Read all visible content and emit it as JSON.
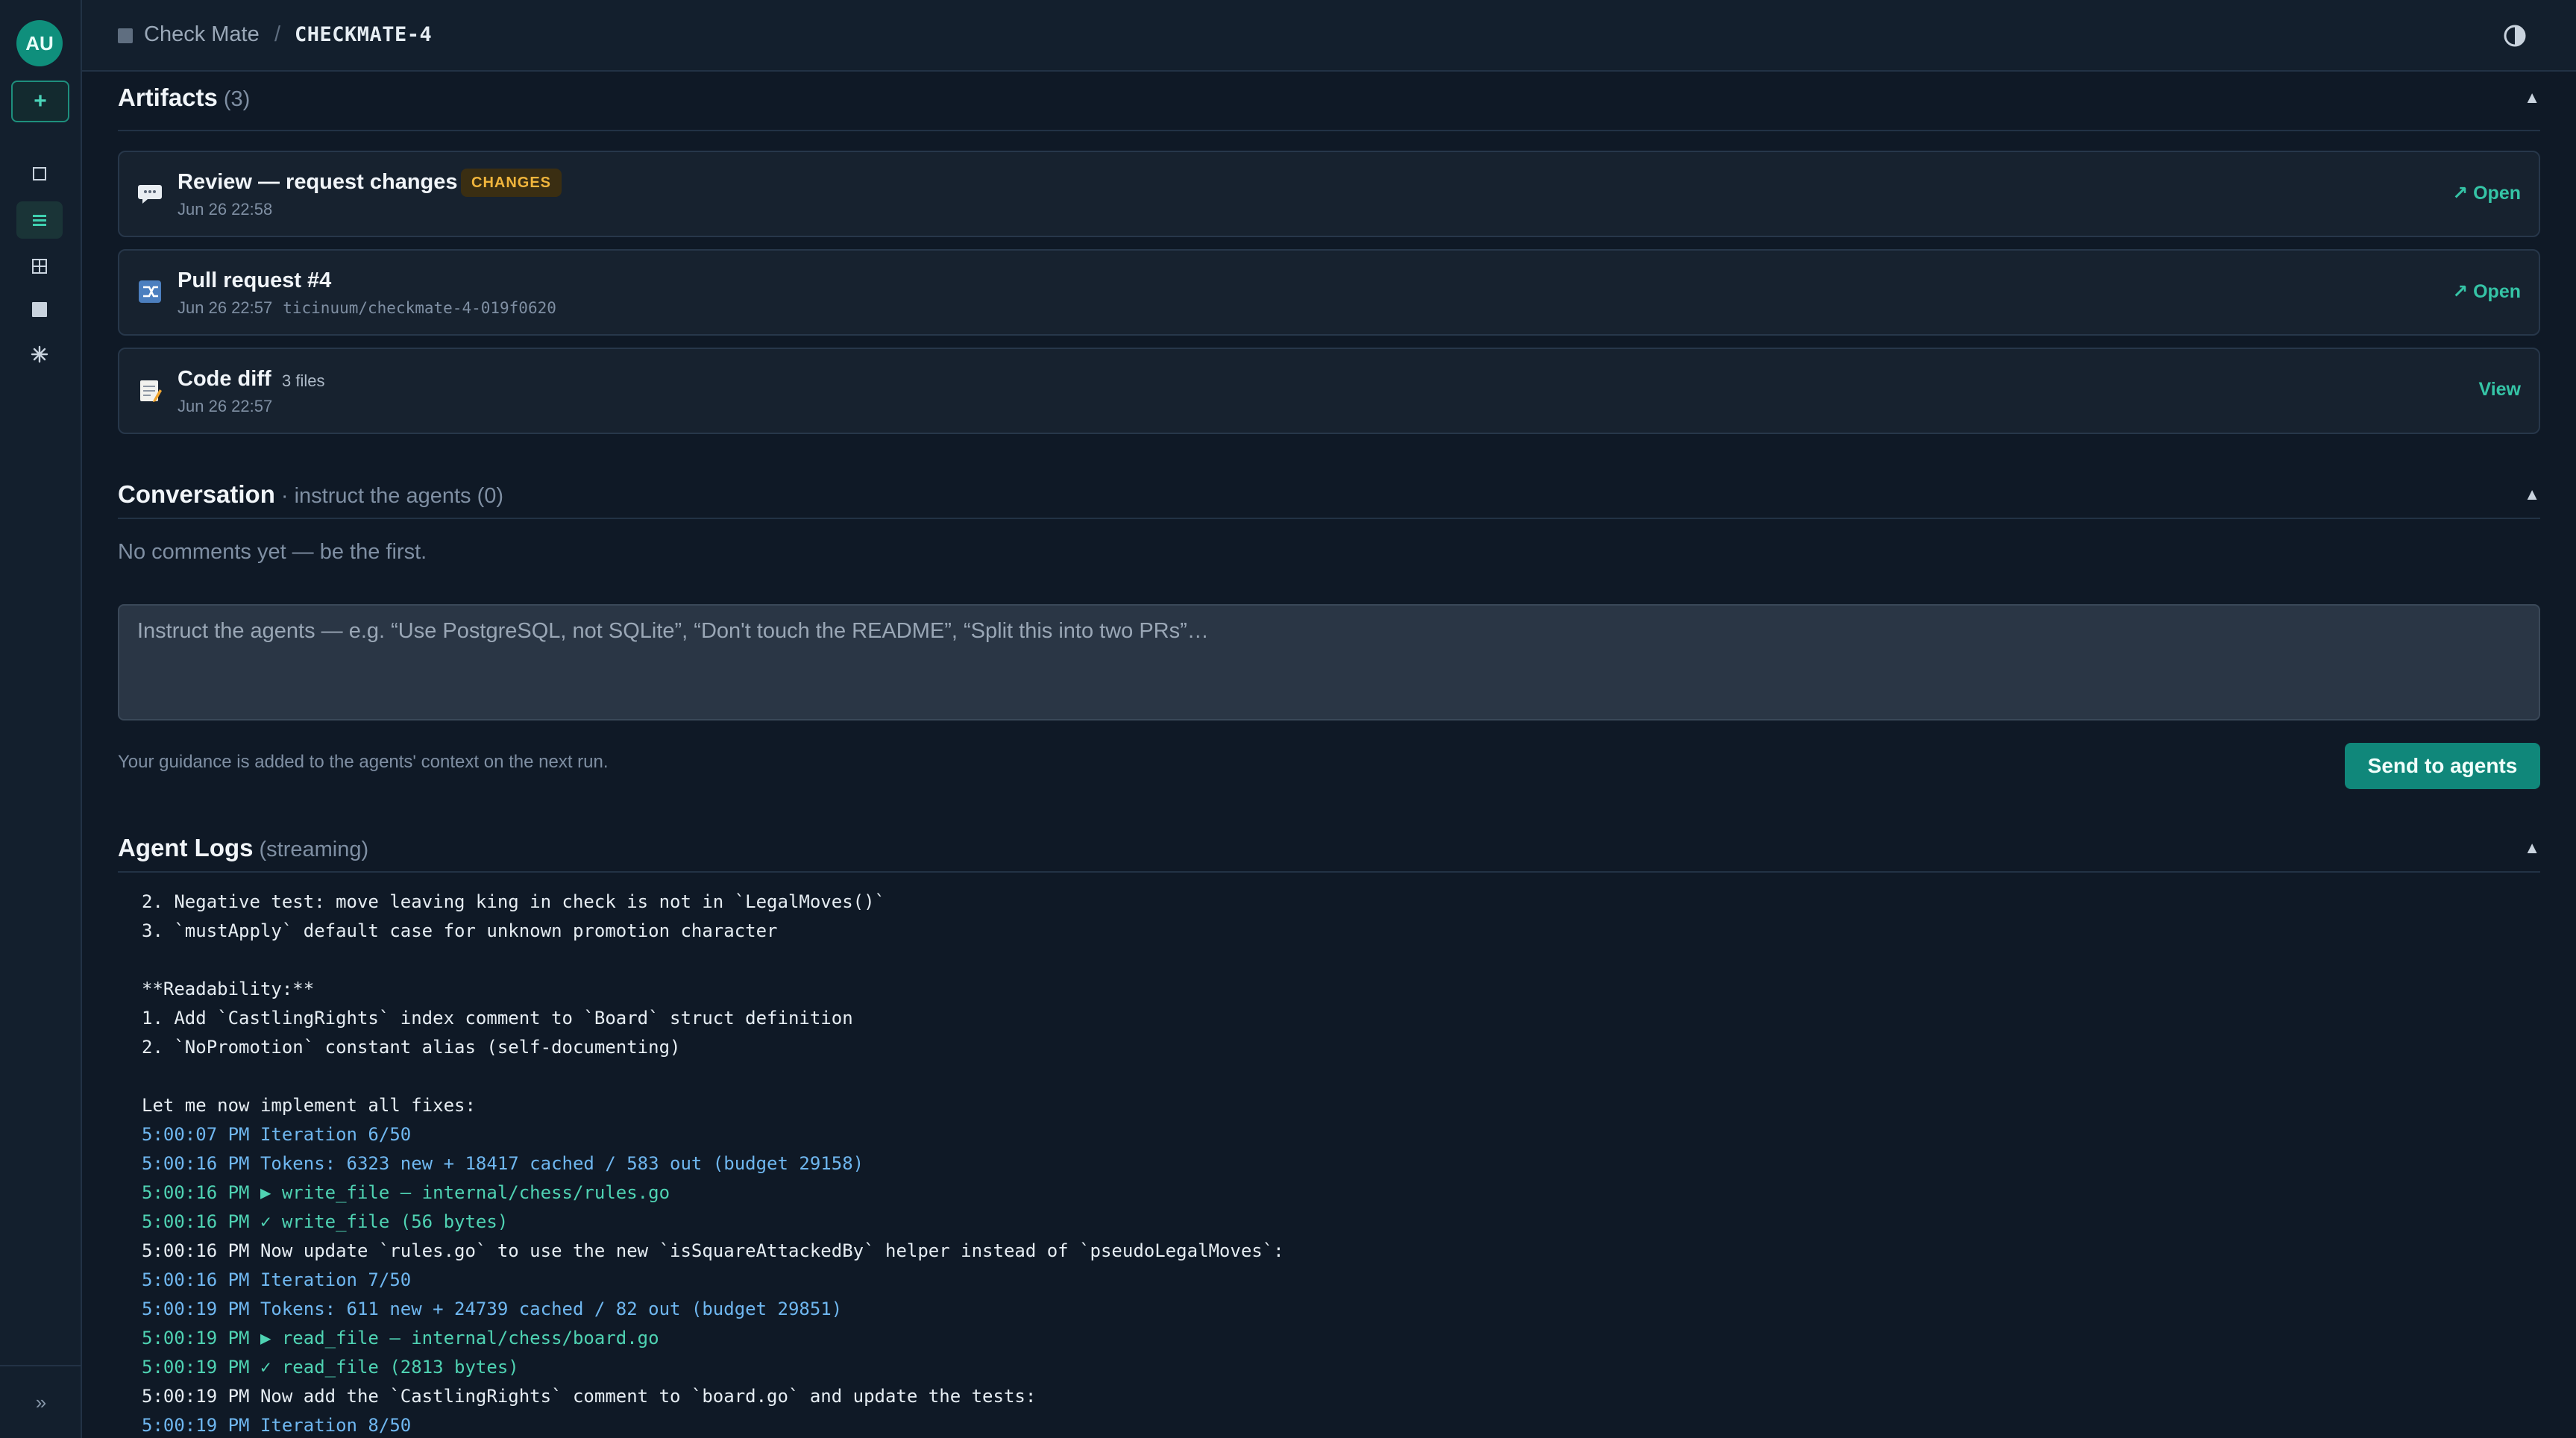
{
  "sidebar": {
    "avatar_initials": "AU",
    "new_label": "+",
    "collapse_label": "»",
    "items": [
      {
        "icon": "square-icon",
        "active": false
      },
      {
        "icon": "list-icon",
        "active": true
      },
      {
        "icon": "grid-icon",
        "active": false
      },
      {
        "icon": "filled-square-icon",
        "active": false
      },
      {
        "icon": "sparkle-icon",
        "active": false
      }
    ]
  },
  "header": {
    "project": "Check Mate",
    "separator": "/",
    "issue_key": "CHECKMATE-4",
    "theme_icon": "contrast-icon"
  },
  "artifacts": {
    "title": "Artifacts",
    "count": "(3)",
    "items": [
      {
        "icon": "comment-icon",
        "title": "Review — request changes",
        "badge": "CHANGES",
        "meta": "Jun 26 22:58",
        "action": "↗ Open"
      },
      {
        "icon": "pull-request-icon",
        "title": "Pull request #4",
        "meta": "Jun 26 22:57",
        "branch": "ticinuum/checkmate-4-019f0620",
        "action": "↗ Open"
      },
      {
        "icon": "memo-icon",
        "title": "Code diff",
        "files": "3 files",
        "meta": "Jun 26 22:57",
        "action": "View"
      }
    ]
  },
  "conversation": {
    "title": "Conversation",
    "subtitle": "· instruct the agents (0)",
    "empty": "No comments yet — be the first.",
    "placeholder": "Instruct the agents — e.g. “Use PostgreSQL, not SQLite”, “Don't touch the README”, “Split this into two PRs”…",
    "hint": "Your guidance is added to the agents' context on the next run.",
    "send_label": "Send to agents"
  },
  "logs": {
    "title": "Agent Logs",
    "status": "(streaming)",
    "lines": [
      {
        "kind": "text",
        "text": "2. Negative test: move leaving king in check is not in `LegalMoves()`"
      },
      {
        "kind": "text",
        "text": "3. `mustApply` default case for unknown promotion character"
      },
      {
        "kind": "text",
        "text": ""
      },
      {
        "kind": "text",
        "text": "**Readability:**"
      },
      {
        "kind": "text",
        "text": "1. Add `CastlingRights` index comment to `Board` struct definition"
      },
      {
        "kind": "text",
        "text": "2. `NoPromotion` constant alias (self-documenting)"
      },
      {
        "kind": "text",
        "text": ""
      },
      {
        "kind": "text",
        "text": "Let me now implement all fixes:"
      },
      {
        "kind": "ts",
        "text": "5:00:07 PM Iteration 6/50"
      },
      {
        "kind": "ts",
        "text": "5:00:16 PM Tokens: 6323 new + 18417 cached / 583 out (budget 29158)"
      },
      {
        "kind": "tool",
        "text": "5:00:16 PM ▶ write_file — internal/chess/rules.go"
      },
      {
        "kind": "tool",
        "text": "5:00:16 PM ✓ write_file (56 bytes)"
      },
      {
        "kind": "text",
        "text": "5:00:16 PM Now update `rules.go` to use the new `isSquareAttackedBy` helper instead of `pseudoLegalMoves`:"
      },
      {
        "kind": "ts",
        "text": "5:00:16 PM Iteration 7/50"
      },
      {
        "kind": "ts",
        "text": "5:00:19 PM Tokens: 611 new + 24739 cached / 82 out (budget 29851)"
      },
      {
        "kind": "tool",
        "text": "5:00:19 PM ▶ read_file — internal/chess/board.go"
      },
      {
        "kind": "tool",
        "text": "5:00:19 PM ✓ read_file (2813 bytes)"
      },
      {
        "kind": "text",
        "text": "5:00:19 PM Now add the `CastlingRights` comment to `board.go` and update the tests:"
      },
      {
        "kind": "ts",
        "text": "5:00:19 PM Iteration 8/50"
      }
    ]
  },
  "colors": {
    "background": "#0f1926",
    "accent": "#10877a",
    "link": "#35c4a6",
    "badge": "#f1b53c",
    "log_timestamp": "#6fb7f0",
    "log_tool": "#4fd3b3"
  }
}
